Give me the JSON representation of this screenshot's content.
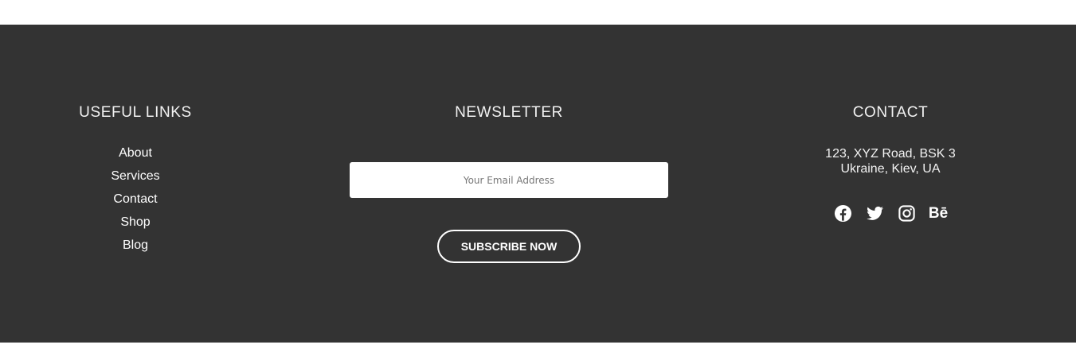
{
  "footer": {
    "background": "#333333",
    "useful_links": {
      "heading": "USEFUL LINKS",
      "items": [
        "About",
        "Services",
        "Contact",
        "Shop",
        "Blog"
      ]
    },
    "newsletter": {
      "heading": "NEWSLETTER",
      "email_placeholder": "Your Email Address",
      "button_label": "SUBSCRIBE NOW"
    },
    "contact": {
      "heading": "CONTACT",
      "address_line1": "123, XYZ Road, BSK 3",
      "address_line2": "Ukraine, Kiev, UA",
      "socials": [
        "facebook-icon",
        "twitter-icon",
        "instagram-icon",
        "behance-icon"
      ],
      "behance_text": "Bē"
    }
  }
}
